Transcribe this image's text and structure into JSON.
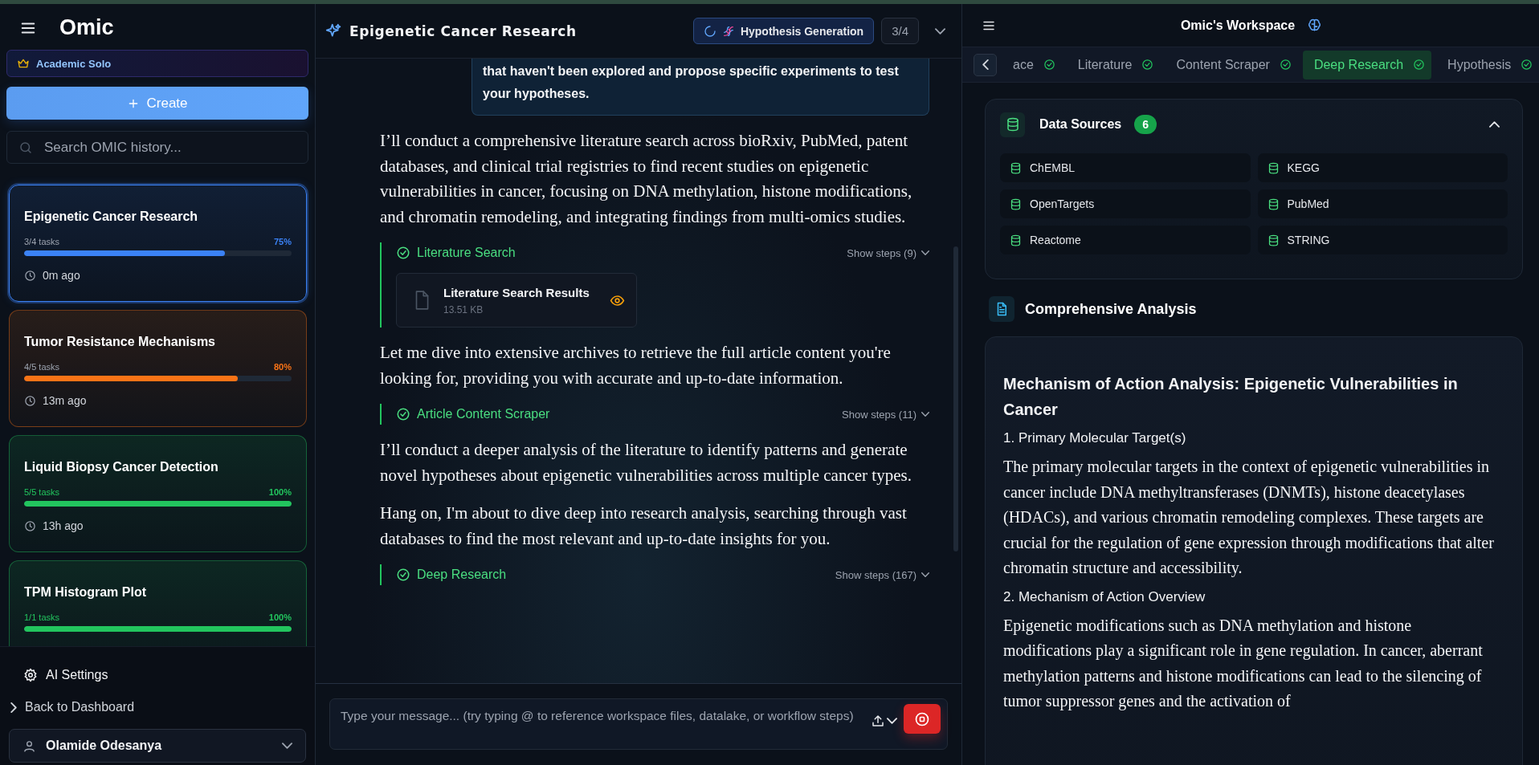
{
  "sidebar": {
    "brand": "Omic",
    "plan": "Academic Solo",
    "create_button": "Create",
    "search": {
      "placeholder": "Search OMIC history..."
    },
    "projects": [
      {
        "title": "Epigenetic Cancer Research",
        "tasks": "3/4 tasks",
        "percent": "75%",
        "level": 0.75,
        "time": "0m ago",
        "selected": true,
        "color": "#3b82f6"
      },
      {
        "title": "Tumor Resistance Mechanisms",
        "tasks": "4/5 tasks",
        "percent": "80%",
        "level": 0.8,
        "time": "13m ago",
        "selected": false,
        "color": "#f97316"
      },
      {
        "title": "Liquid Biopsy Cancer Detection",
        "tasks": "5/5 tasks",
        "percent": "100%",
        "level": 1,
        "time": "13h ago",
        "selected": false,
        "color": "#22c55e"
      },
      {
        "title": "TPM Histogram Plot",
        "tasks": "1/1 tasks",
        "percent": "100%",
        "level": 1,
        "selected": false,
        "color": "#22c55e"
      }
    ],
    "settings": "AI Settings",
    "back_link": "Back to Dashboard",
    "user": "Olamide Odesanya"
  },
  "chat": {
    "title": "Epigenetic Cancer Research",
    "current_step": {
      "label": "Hypothesis Generation",
      "running": true
    },
    "progress": "3/4",
    "messages": [
      {
        "kind": "user",
        "text": "that haven't been explored and propose specific experiments to test your hypotheses."
      },
      {
        "kind": "assistant",
        "text": "I’ll conduct a comprehensive literature search across bioRxiv, PubMed, patent databases, and clinical trial registries to find recent studies on epigenetic vulnerabilities in cancer, focusing on DNA methylation, histone modifications, and chromatin remodeling, and integrating findings from multi-omics studies."
      },
      {
        "kind": "step",
        "title": "Literature Search",
        "done": true,
        "toggle": "Show steps (9)",
        "files": [
          {
            "name": "Literature Search Results",
            "size": "13.51 KB"
          }
        ]
      },
      {
        "kind": "assistant",
        "text": "Let me dive into extensive archives to retrieve the full article content you're looking for, providing you with accurate and up-to-date information."
      },
      {
        "kind": "step",
        "title": "Article Content Scraper",
        "done": true,
        "toggle": "Show steps (11)"
      },
      {
        "kind": "assistant",
        "text": "I’ll conduct a deeper analysis of the literature to identify patterns and generate novel hypotheses about epigenetic vulnerabilities across multiple cancer types."
      },
      {
        "kind": "assistant",
        "text": "Hang on, I'm about to dive deep into research analysis, searching through vast databases to find the most relevant and up-to-date insights for you."
      },
      {
        "kind": "step",
        "title": "Deep Research",
        "done": true,
        "toggle": "Show steps (167)"
      }
    ],
    "input": {
      "placeholder": "Type your message... (try typing @ to reference workspace files, datalake, or workflow steps)"
    }
  },
  "workspace": {
    "title": "Omic's Workspace",
    "tabs": [
      {
        "label": "ace",
        "done": true,
        "selected": false
      },
      {
        "label": "Literature",
        "done": true,
        "selected": false
      },
      {
        "label": "Content Scraper",
        "done": true,
        "selected": false
      },
      {
        "label": "Deep Research",
        "done": true,
        "selected": true
      },
      {
        "label": "Hypothesis",
        "done": true,
        "selected": false
      }
    ],
    "data_sources": {
      "title": "Data Sources",
      "count": "6",
      "expanded": true,
      "items": [
        "ChEMBL",
        "KEGG",
        "OpenTargets",
        "PubMed",
        "Reactome",
        "STRING"
      ]
    },
    "analysis": {
      "title": "Comprehensive Analysis",
      "heading": "Mechanism of Action Analysis: Epigenetic Vulnerabilities in Cancer",
      "sections": [
        {
          "heading": "1. Primary Molecular Target(s)",
          "text": "The primary molecular targets in the context of epigenetic vulnerabilities in cancer include DNA methyltransferases (DNMTs), histone deacetylases (HDACs), and various chromatin remodeling complexes. These targets are crucial for the regulation of gene expression through modifications that alter chromatin structure and accessibility."
        },
        {
          "heading": "2. Mechanism of Action Overview",
          "text": "Epigenetic modifications such as DNA methylation and histone modifications play a significant role in gene regulation. In cancer, aberrant methylation patterns and histone modifications can lead to the silencing of tumor suppressor genes and the activation of"
        }
      ]
    }
  }
}
